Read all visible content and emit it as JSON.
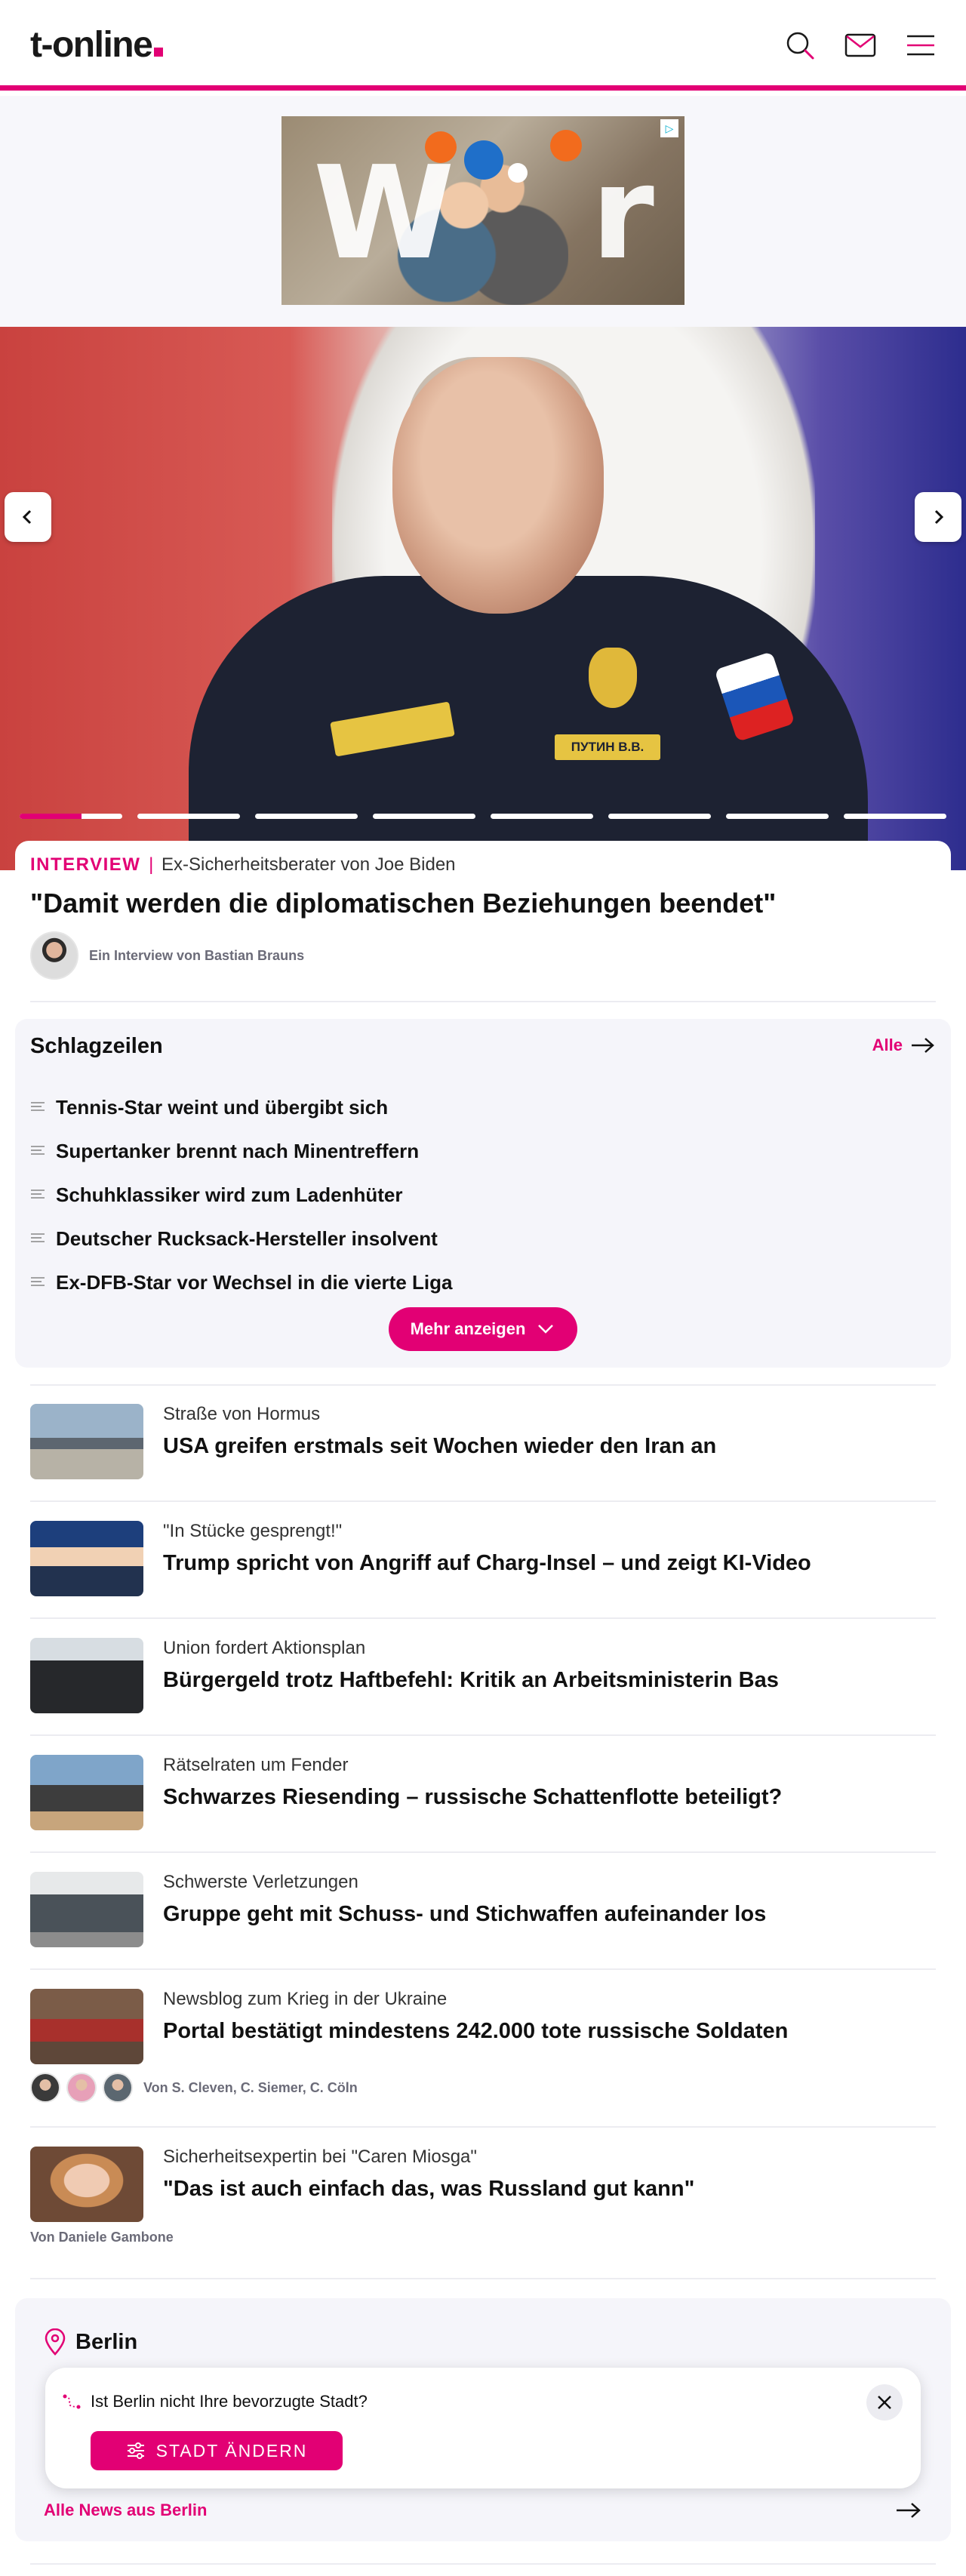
{
  "header": {
    "logo_text": "t-online",
    "brand_color": "#e20074",
    "icons": [
      "search-icon",
      "mail-icon",
      "menu-icon"
    ]
  },
  "ad": {
    "letters_left": "W",
    "letters_right": "r",
    "adchoices_icon": "adchoices-icon"
  },
  "hero": {
    "badge_text": "ПУТИН В.В.",
    "slide_count": 8,
    "active_slide": 0,
    "active_progress": 0.6,
    "kicker_label": "INTERVIEW",
    "kicker_separator": "|",
    "kicker_text": "Ex-Sicherheitsberater von Joe Biden",
    "title": "\"Damit werden die diplomatischen Beziehungen beendet\"",
    "author": "Ein Interview von Bastian Brauns"
  },
  "headlines": {
    "title": "Schlagzeilen",
    "all_label": "Alle",
    "items": [
      "Tennis-Star weint und übergibt sich",
      "Supertanker brennt nach Minentreffern",
      "Schuhklassiker wird zum Ladenhüter",
      "Deutscher Rucksack-Hersteller insolvent",
      "Ex-DFB-Star vor Wechsel in die vierte Liga"
    ],
    "more_label": "Mehr anzeigen"
  },
  "articles": [
    {
      "kicker": "Straße von Hormus",
      "title": "USA greifen erstmals seit Wochen wieder den Iran an"
    },
    {
      "kicker": "\"In Stücke gesprengt!\"",
      "title": "Trump spricht von Angriff auf Charg-Insel – und zeigt KI-Video"
    },
    {
      "kicker": "Union fordert Aktionsplan",
      "title": "Bürgergeld trotz Haftbefehl: Kritik an Arbeitsministerin Bas"
    },
    {
      "kicker": "Rätselraten um Fender",
      "title": "Schwarzes Riesending – russische Schattenflotte beteiligt?"
    },
    {
      "kicker": "Schwerste Verletzungen",
      "title": "Gruppe geht mit Schuss- und Stichwaffen aufeinander los"
    },
    {
      "kicker": "Newsblog zum Krieg in der Ukraine",
      "title": "Portal bestätigt mindestens 242.000 tote russische Soldaten",
      "byline": "Von S. Cleven, C. Siemer, C. Cöln"
    },
    {
      "kicker": "Sicherheitsexpertin bei \"Caren Miosga\"",
      "title": "\"Das ist auch einfach das, was Russland gut kann\"",
      "byline": "Von Daniele Gambone"
    }
  ],
  "berlin": {
    "city": "Berlin",
    "question": "Ist Berlin nicht Ihre bevorzugte Stadt?",
    "change_label": "STADT ÄNDERN",
    "all_news": "Alle News aus Berlin"
  }
}
